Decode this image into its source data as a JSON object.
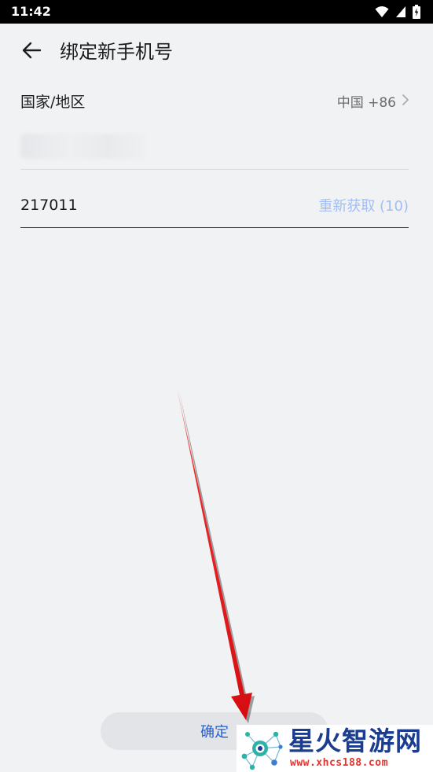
{
  "status_bar": {
    "time": "11:42",
    "icons": [
      "wifi-icon",
      "cellular-signal-icon",
      "battery-charging-icon"
    ]
  },
  "header": {
    "back_icon": "arrow-left-icon",
    "title": "绑定新手机号"
  },
  "form": {
    "region_label": "国家/地区",
    "region_value": "中国 +86",
    "region_chevron_icon": "chevron-right-icon",
    "code_value": "217011",
    "resend_label": "重新获取 (10)"
  },
  "footer": {
    "confirm_label": "确定"
  },
  "watermark": {
    "title": "星火智游网",
    "url": "www.xhcs188.com"
  },
  "colors": {
    "background": "#f1f2f4",
    "accent": "#1f5fd6",
    "resend_disabled": "#a3bdf2",
    "annotation_arrow": "#e2111a"
  }
}
